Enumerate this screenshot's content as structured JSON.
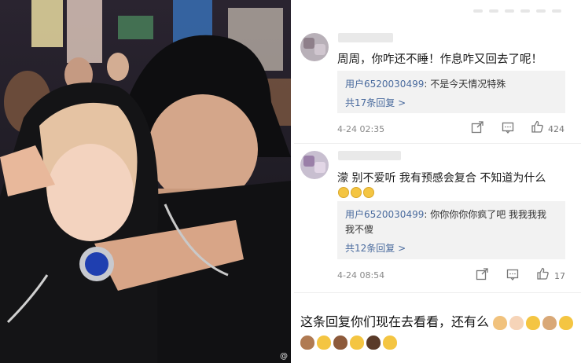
{
  "photo": {
    "watermark": "@"
  },
  "comments": [
    {
      "text": "周周，你咋还不睡！作息咋又回去了呢！",
      "reply_user": "用户6520030499",
      "reply_sep": ":",
      "reply_text": "不是今天情况特殊",
      "reply_more": "共17条回复 >",
      "time": "4-24 02:35",
      "likes": "424"
    },
    {
      "text": "濛 别不爱听 我有预感会复合 不知道为什么",
      "reply_user": "用户6520030499",
      "reply_sep": ":",
      "reply_text": "你你你你你疯了吧 我我我我",
      "reply_text2": "我不傻",
      "reply_more": "共12条回复 >",
      "time": "4-24 08:54",
      "likes": "17"
    }
  ],
  "caption": {
    "line1": "这条回复你们现在去看看，还有么"
  },
  "icon_names": [
    "share-icon",
    "comment-icon",
    "like-icon"
  ],
  "colors": {
    "link": "#4a6b9e",
    "reply_bg": "#f2f2f2",
    "emoji": "#f4c542"
  }
}
